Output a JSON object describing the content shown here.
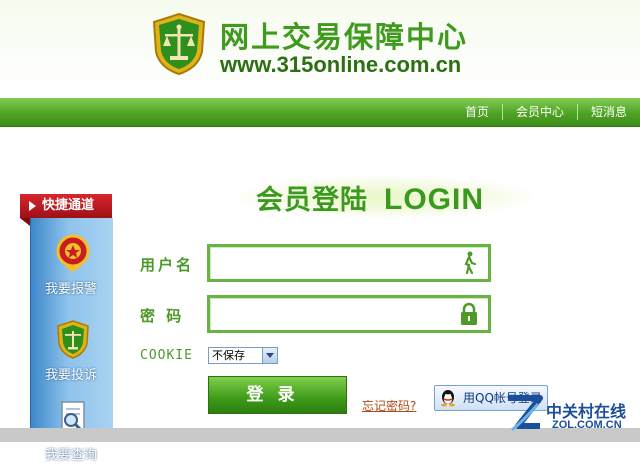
{
  "header": {
    "site_title": "网上交易保障中心",
    "site_url": "www.315online.com.cn",
    "logo_icon": "scales-shield-logo"
  },
  "nav": {
    "items": [
      {
        "label": "首页"
      },
      {
        "label": "会员中心"
      },
      {
        "label": "短消息"
      }
    ]
  },
  "sidebar": {
    "title": "快捷通道",
    "items": [
      {
        "label": "我要报警",
        "icon": "police-badge-icon"
      },
      {
        "label": "我要投诉",
        "icon": "complaint-shield-icon"
      },
      {
        "label": "我要查询",
        "icon": "search-document-icon"
      }
    ]
  },
  "login": {
    "title_cn": "会员登陆",
    "title_en": "LOGIN",
    "username_label": "用户名",
    "username_value": "",
    "password_label": "密 码",
    "password_value": "",
    "cookie_label": "COOKIE",
    "cookie_selected": "不保存",
    "submit_label": "登录",
    "forgot_label": "忘记密码?",
    "qq_label": "用QQ帐号登录"
  },
  "watermark": {
    "cn": "中关村在线",
    "en": "ZOL.COM.CN"
  },
  "colors": {
    "brand_green": "#4ea323",
    "label_green": "#4d9a2a",
    "sidebar_red": "#c41a20",
    "sidebar_blue": "#6aa8dc"
  }
}
